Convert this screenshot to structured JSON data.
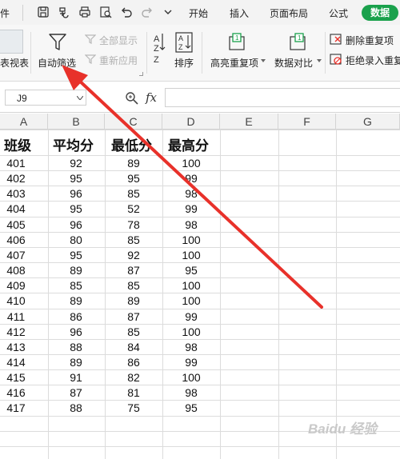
{
  "toolbar": {
    "left_fragment": "件",
    "tabs": [
      "开始",
      "插入",
      "页面布局",
      "公式",
      "数据"
    ]
  },
  "ribbon": {
    "pivot_label": "表视表",
    "auto_filter": "自动筛选",
    "show_all": "全部显示",
    "reapply": "重新应用",
    "sort": "排序",
    "highlight_dup": "高亮重复项",
    "data_compare": "数据对比",
    "delete_dup": "删除重复项",
    "reject_dup": "拒绝录入重复"
  },
  "formula_bar": {
    "cell_ref": "J9",
    "fx": "fx"
  },
  "columns": [
    "A",
    "B",
    "C",
    "D",
    "E",
    "F",
    "G"
  ],
  "table": {
    "headers": [
      "班级",
      "平均分",
      "最低分",
      "最高分"
    ],
    "rows": [
      [
        "401",
        "92",
        "89",
        "100"
      ],
      [
        "402",
        "95",
        "95",
        "99"
      ],
      [
        "403",
        "96",
        "85",
        "98"
      ],
      [
        "404",
        "95",
        "52",
        "99"
      ],
      [
        "405",
        "96",
        "78",
        "98"
      ],
      [
        "406",
        "80",
        "85",
        "100"
      ],
      [
        "407",
        "95",
        "92",
        "100"
      ],
      [
        "408",
        "89",
        "87",
        "95"
      ],
      [
        "409",
        "85",
        "85",
        "100"
      ],
      [
        "410",
        "89",
        "89",
        "100"
      ],
      [
        "411",
        "86",
        "87",
        "99"
      ],
      [
        "412",
        "96",
        "85",
        "100"
      ],
      [
        "413",
        "88",
        "84",
        "98"
      ],
      [
        "414",
        "89",
        "86",
        "99"
      ],
      [
        "415",
        "91",
        "82",
        "100"
      ],
      [
        "416",
        "87",
        "81",
        "98"
      ],
      [
        "417",
        "88",
        "75",
        "95"
      ]
    ]
  },
  "watermark": "Baidu 经验",
  "colors": {
    "data_tab": "#1aa14c",
    "arrow": "#e8312a",
    "header_bg": "#f2f2f2"
  }
}
